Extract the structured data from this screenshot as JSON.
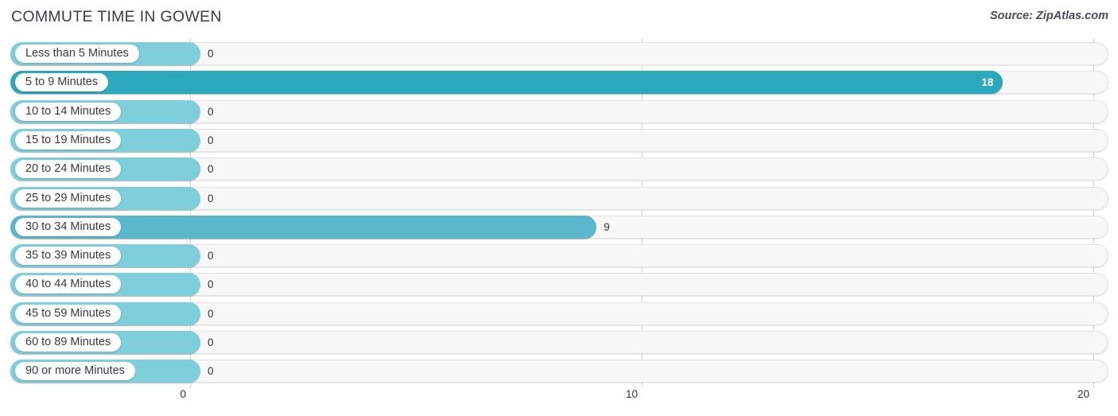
{
  "header": {
    "title": "COMMUTE TIME IN GOWEN",
    "source": "Source: ZipAtlas.com"
  },
  "colors": {
    "bar_highlight": "#2ba8bc",
    "bar_mid": "#5bb8cc",
    "bar_light": "#7ecedb",
    "track_fill": "#f7f7f7",
    "track_border": "#e3e3e3",
    "gridline": "#d2d2d2",
    "title_text": "#3c3c47",
    "value_text": "#333333"
  },
  "chart_data": {
    "type": "bar",
    "orientation": "horizontal",
    "title": "COMMUTE TIME IN GOWEN",
    "xlabel": "",
    "ylabel": "",
    "xlim": [
      0,
      20
    ],
    "grid": true,
    "legend": null,
    "xticks": [
      "0",
      "10",
      "20"
    ],
    "xtick_values": [
      0,
      10,
      20
    ],
    "categories": [
      "Less than 5 Minutes",
      "5 to 9 Minutes",
      "10 to 14 Minutes",
      "15 to 19 Minutes",
      "20 to 24 Minutes",
      "25 to 29 Minutes",
      "30 to 34 Minutes",
      "35 to 39 Minutes",
      "40 to 44 Minutes",
      "45 to 59 Minutes",
      "60 to 89 Minutes",
      "90 or more Minutes"
    ],
    "values": [
      0,
      18,
      0,
      0,
      0,
      0,
      9,
      0,
      0,
      0,
      0,
      0
    ],
    "value_labels": [
      "0",
      "18",
      "0",
      "0",
      "0",
      "0",
      "9",
      "0",
      "0",
      "0",
      "0",
      "0"
    ]
  },
  "rows": [
    {
      "label": "Less than 5 Minutes",
      "value": 0,
      "value_label": "0",
      "color": "#7ecedb",
      "label_inside": true
    },
    {
      "label": "5 to 9 Minutes",
      "value": 18,
      "value_label": "18",
      "color": "#2ba8bc",
      "label_inside": true
    },
    {
      "label": "10 to 14 Minutes",
      "value": 0,
      "value_label": "0",
      "color": "#7ecedb",
      "label_inside": true
    },
    {
      "label": "15 to 19 Minutes",
      "value": 0,
      "value_label": "0",
      "color": "#7ecedb",
      "label_inside": true
    },
    {
      "label": "20 to 24 Minutes",
      "value": 0,
      "value_label": "0",
      "color": "#7ecedb",
      "label_inside": true
    },
    {
      "label": "25 to 29 Minutes",
      "value": 0,
      "value_label": "0",
      "color": "#7ecedb",
      "label_inside": true
    },
    {
      "label": "30 to 34 Minutes",
      "value": 9,
      "value_label": "9",
      "color": "#5bb8cc",
      "label_inside": true
    },
    {
      "label": "35 to 39 Minutes",
      "value": 0,
      "value_label": "0",
      "color": "#7ecedb",
      "label_inside": true
    },
    {
      "label": "40 to 44 Minutes",
      "value": 0,
      "value_label": "0",
      "color": "#7ecedb",
      "label_inside": true
    },
    {
      "label": "45 to 59 Minutes",
      "value": 0,
      "value_label": "0",
      "color": "#7ecedb",
      "label_inside": true
    },
    {
      "label": "60 to 89 Minutes",
      "value": 0,
      "value_label": "0",
      "color": "#7ecedb",
      "label_inside": true
    },
    {
      "label": "90 or more Minutes",
      "value": 0,
      "value_label": "0",
      "color": "#7ecedb",
      "label_inside": true
    }
  ]
}
